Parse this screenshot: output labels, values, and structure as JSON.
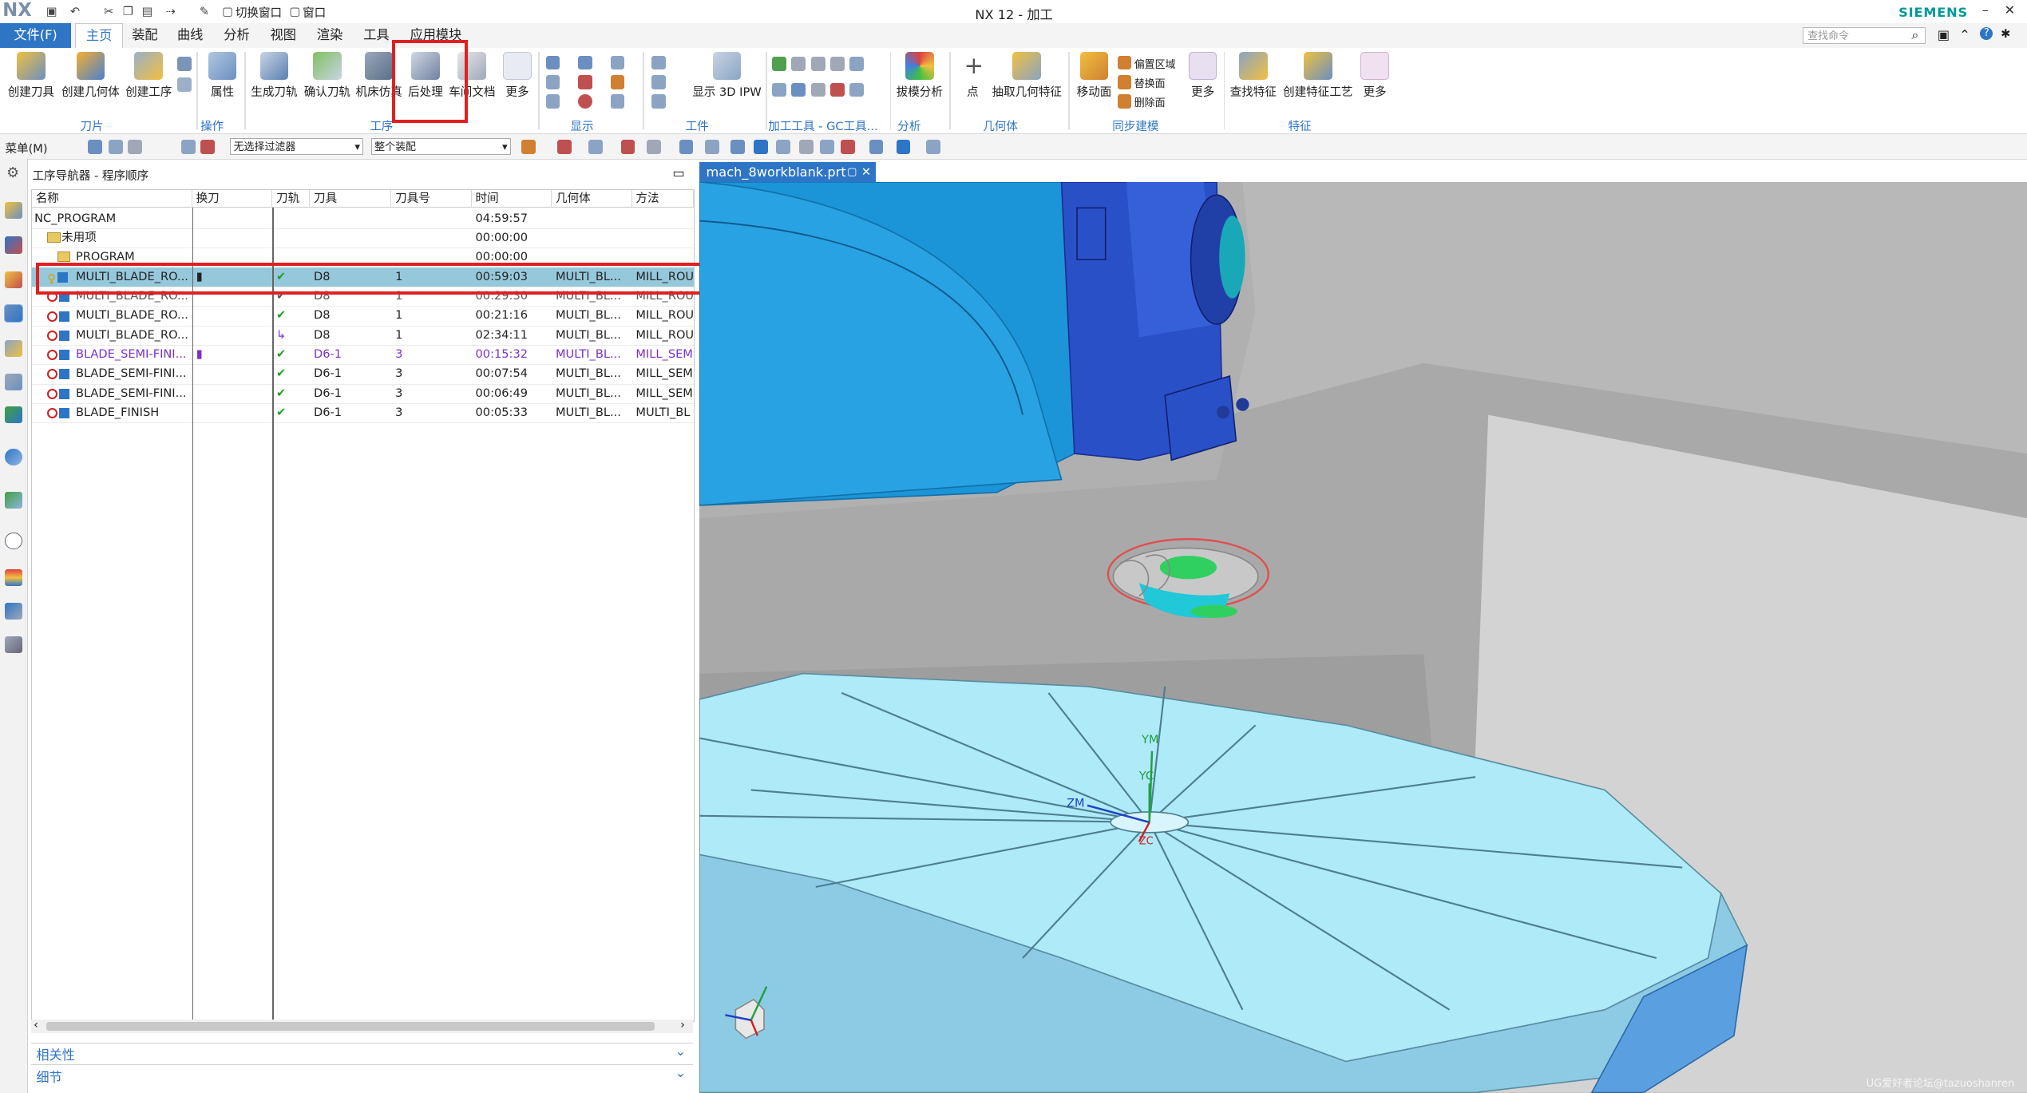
{
  "app": {
    "logo": "NX",
    "title": "NX 12 - 加工",
    "brand": "SIEMENS",
    "quick_access": {
      "switch_window": "切换窗口",
      "window": "窗口"
    }
  },
  "menu": {
    "file": "文件(F)",
    "tabs": [
      "主页",
      "装配",
      "曲线",
      "分析",
      "视图",
      "渲染",
      "工具",
      "应用模块"
    ],
    "search_placeholder": "查找命令"
  },
  "ribbon": {
    "buttons": {
      "create_tool": "创建刀具",
      "create_geometry": "创建几何体",
      "create_operation": "创建工序",
      "properties": "属性",
      "generate_path": "生成刀轨",
      "verify_path": "确认刀轨",
      "machine_sim": "机床仿真",
      "postprocess": "后处理",
      "shop_doc": "车间文档",
      "more1": "更多",
      "show_ipw": "显示 3D IPW",
      "draft_analysis": "拔模分析",
      "point": "点",
      "extract_geometry": "抽取几何特征",
      "move_face": "移动面",
      "offset_region": "偏置区域",
      "replace_face": "替换面",
      "delete_face": "删除面",
      "more2": "更多",
      "find_feature": "查找特征",
      "create_feature_process": "创建特征工艺",
      "more3": "更多"
    },
    "groups": [
      "刀片",
      "操作",
      "工序",
      "显示",
      "工件",
      "加工工具 - GC工具...",
      "分析",
      "几何体",
      "同步建模",
      "特征"
    ]
  },
  "toolbar2": {
    "menu": "菜单(M)",
    "filter": "无选择过滤器",
    "assembly": "整个装配"
  },
  "navigator": {
    "title": "工序导航器 - 程序顺序",
    "columns": [
      "名称",
      "换刀",
      "刀轨",
      "刀具",
      "刀具号",
      "时间",
      "几何体",
      "方法"
    ],
    "rows": [
      {
        "name": "NC_PROGRAM",
        "toolchange": "",
        "path": "",
        "tool": "",
        "toolno": "",
        "time": "04:59:57",
        "geom": "",
        "method": ""
      },
      {
        "name": "未用项",
        "toolchange": "",
        "path": "",
        "tool": "",
        "toolno": "",
        "time": "00:00:00",
        "geom": "",
        "method": ""
      },
      {
        "name": "PROGRAM",
        "toolchange": "",
        "path": "",
        "tool": "",
        "toolno": "",
        "time": "00:00:00",
        "geom": "",
        "method": ""
      },
      {
        "name": "MULTI_BLADE_RO...",
        "toolchange": "▮",
        "path": "✔",
        "tool": "D8",
        "toolno": "1",
        "time": "00:59:03",
        "geom": "MULTI_BL...",
        "method": "MILL_ROU"
      },
      {
        "name": "MULTI_BLADE_RO...",
        "toolchange": "",
        "path": "✔",
        "tool": "D8",
        "toolno": "1",
        "time": "00:29:30",
        "geom": "MULTI_BL...",
        "method": "MILL_ROU"
      },
      {
        "name": "MULTI_BLADE_RO...",
        "toolchange": "",
        "path": "✔",
        "tool": "D8",
        "toolno": "1",
        "time": "00:21:16",
        "geom": "MULTI_BL...",
        "method": "MILL_ROU"
      },
      {
        "name": "MULTI_BLADE_RO...",
        "toolchange": "",
        "path": "↳",
        "tool": "D8",
        "toolno": "1",
        "time": "02:34:11",
        "geom": "MULTI_BL...",
        "method": "MILL_ROU"
      },
      {
        "name": "BLADE_SEMI-FINI...",
        "toolchange": "▮",
        "path": "✔",
        "tool": "D6-1",
        "toolno": "3",
        "time": "00:15:32",
        "geom": "MULTI_BL...",
        "method": "MILL_SEM"
      },
      {
        "name": "BLADE_SEMI-FINI...",
        "toolchange": "",
        "path": "✔",
        "tool": "D6-1",
        "toolno": "3",
        "time": "00:07:54",
        "geom": "MULTI_BL...",
        "method": "MILL_SEM"
      },
      {
        "name": "BLADE_SEMI-FINI...",
        "toolchange": "",
        "path": "✔",
        "tool": "D6-1",
        "toolno": "3",
        "time": "00:06:49",
        "geom": "MULTI_BL...",
        "method": "MILL_SEM"
      },
      {
        "name": "BLADE_FINISH",
        "toolchange": "",
        "path": "✔",
        "tool": "D6-1",
        "toolno": "3",
        "time": "00:05:33",
        "geom": "MULTI_BL...",
        "method": "MULTI_BL"
      }
    ],
    "accordions": [
      "相关性",
      "细节"
    ]
  },
  "graphics": {
    "tab": "mach_8workblank.prt",
    "axes": {
      "ym": "YM",
      "yc": "YC",
      "zm": "ZM",
      "zc": "ZC"
    }
  },
  "watermark": "UG爱好者论坛@tazuoshanren",
  "colors": {
    "accent": "#2e75c6",
    "highlight": "#e02020",
    "selected_row": "#96c8dc",
    "machine_blue": "#1e88d8",
    "table_light": "#aee8f6"
  }
}
